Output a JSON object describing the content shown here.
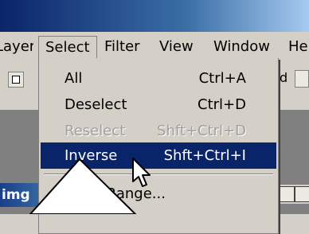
{
  "menubar": {
    "layer_label": "Layer",
    "select_label": "Select",
    "filter_label": "Filter",
    "view_label": "View",
    "window_label": "Window",
    "help_label": "He"
  },
  "toolbar": {
    "right_text": "d"
  },
  "select_menu": {
    "items": [
      {
        "label": "All",
        "shortcut": "Ctrl+A",
        "enabled": true,
        "highlighted": false
      },
      {
        "label": "Deselect",
        "shortcut": "Ctrl+D",
        "enabled": true,
        "highlighted": false
      },
      {
        "label": "Reselect",
        "shortcut": "Shft+Ctrl+D",
        "enabled": false,
        "highlighted": false
      },
      {
        "label": "Inverse",
        "shortcut": "Shft+Ctrl+I",
        "enabled": true,
        "highlighted": true
      },
      {
        "label": "Color Range...",
        "shortcut": "",
        "enabled": true,
        "highlighted": false
      }
    ]
  },
  "document": {
    "tab_label": "img"
  },
  "colors": {
    "menu_highlight": "#0a246a",
    "menu_bg": "#d4d0c8",
    "disabled_text": "#a0a0a0"
  },
  "icons": {
    "cursor": "arrow-cursor-icon",
    "tool": "selection-tool-icon"
  }
}
